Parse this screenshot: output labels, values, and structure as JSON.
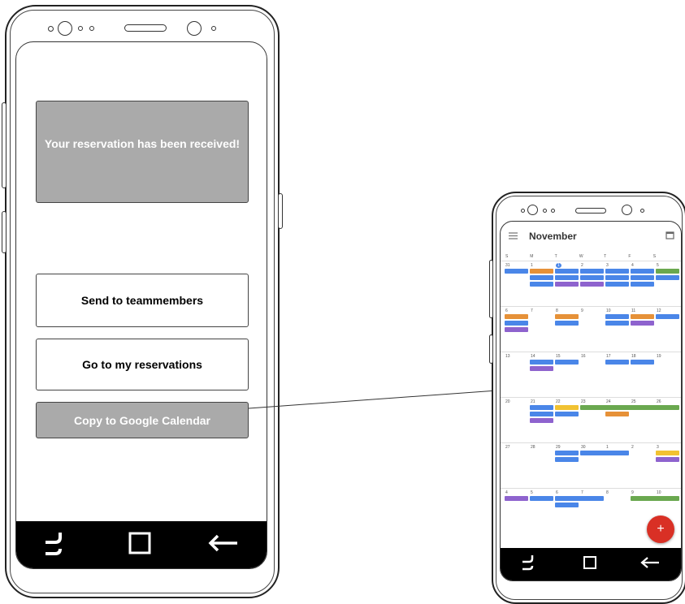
{
  "main_phone": {
    "message": "Your reservation has been received!",
    "buttons": {
      "send": "Send to teammembers",
      "reservations": "Go to my reservations",
      "calendar": "Copy to Google Calendar"
    }
  },
  "calendar_phone": {
    "month": "November",
    "weekday_heads": [
      "S",
      "M",
      "T",
      "W",
      "T",
      "F",
      "S"
    ],
    "weeks": [
      [
        "31",
        "1",
        "1",
        "2",
        "3",
        "4",
        "5"
      ],
      [
        "6",
        "7",
        "8",
        "9",
        "10",
        "11",
        "12"
      ],
      [
        "13",
        "14",
        "15",
        "16",
        "17",
        "18",
        "19"
      ],
      [
        "20",
        "21",
        "22",
        "23",
        "24",
        "25",
        "26"
      ],
      [
        "27",
        "28",
        "29",
        "30",
        "1",
        "2",
        "3"
      ],
      [
        "4",
        "5",
        "6",
        "7",
        "8",
        "9",
        "10"
      ]
    ],
    "fab_label": "+"
  },
  "nav_icons": [
    "recent-apps-icon",
    "home-icon",
    "back-icon"
  ],
  "colors": {
    "blue": "#4a86e8",
    "orange": "#e69138",
    "green": "#6aa84f",
    "purple": "#8e63ce",
    "yellow": "#f1c232",
    "fab": "#d93025"
  }
}
